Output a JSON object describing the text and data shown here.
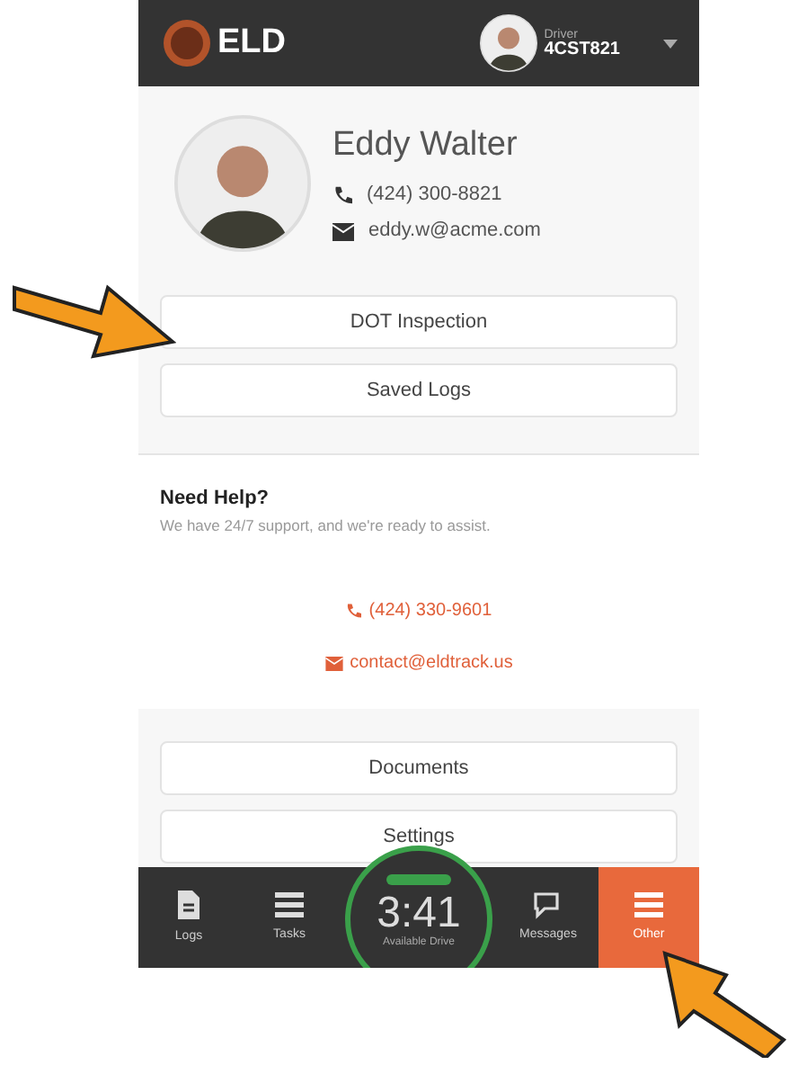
{
  "header": {
    "logo": "ELD",
    "driver_label": "Driver",
    "driver_id": "4CST821"
  },
  "profile": {
    "name": "Eddy Walter",
    "phone": "(424) 300-8821",
    "email": "eddy.w@acme.com"
  },
  "menu_top": [
    {
      "label": "DOT Inspection"
    },
    {
      "label": "Saved Logs"
    }
  ],
  "help": {
    "title": "Need Help?",
    "text": "We have 24/7 support, and we're ready to assist.",
    "phone": "(424) 330-9601",
    "email": "contact@eldtrack.us"
  },
  "menu_bottom": [
    {
      "label": "Documents"
    },
    {
      "label": "Settings"
    }
  ],
  "nav": [
    {
      "label": "Logs",
      "kind": "document",
      "selected": false
    },
    {
      "label": "Tasks",
      "kind": "list",
      "selected": false
    },
    {
      "label": "Messages",
      "kind": "chat",
      "selected": false
    },
    {
      "label": "Other",
      "kind": "menu",
      "selected": true
    }
  ],
  "timer": {
    "time": "3:41",
    "label": "Available Drive"
  }
}
